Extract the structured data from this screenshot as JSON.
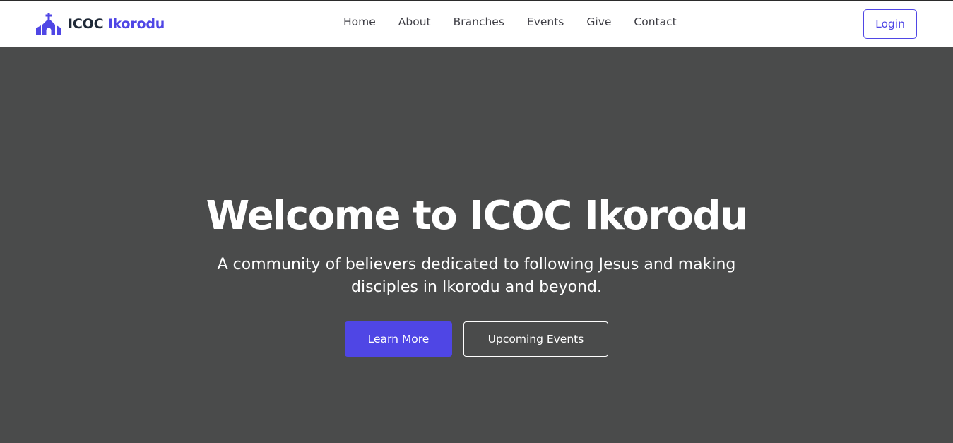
{
  "brand": {
    "icon": "church-icon",
    "name_part1": "ICOC",
    "name_part2": "Ikorodu"
  },
  "nav": {
    "items": [
      {
        "label": "Home"
      },
      {
        "label": "About"
      },
      {
        "label": "Branches"
      },
      {
        "label": "Events"
      },
      {
        "label": "Give"
      },
      {
        "label": "Contact"
      }
    ],
    "login_label": "Login"
  },
  "hero": {
    "title": "Welcome to ICOC Ikorodu",
    "subtitle": "A community of believers dedicated to following Jesus and making disciples in Ikorodu and beyond.",
    "primary_button": "Learn More",
    "secondary_button": "Upcoming Events"
  },
  "colors": {
    "accent": "#4f46e5",
    "hero_background": "#4a4b4b",
    "navbar_background": "#ffffff"
  }
}
